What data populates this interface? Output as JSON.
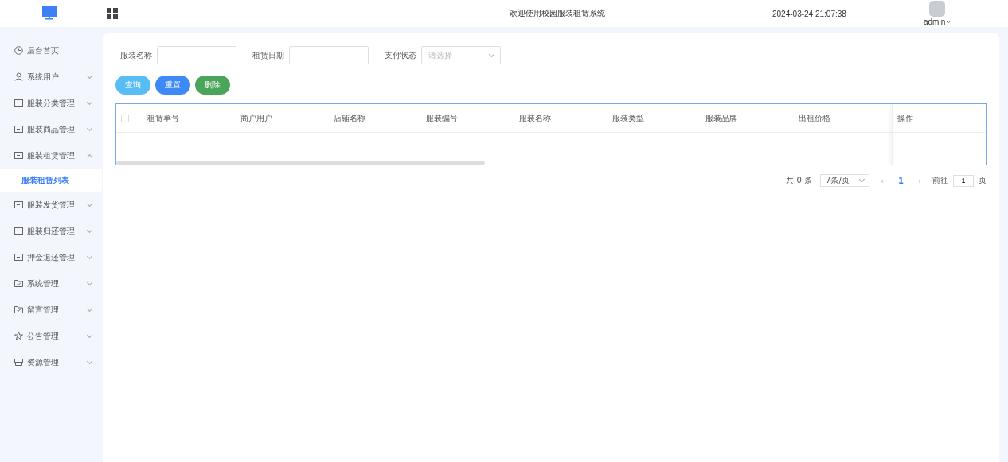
{
  "header": {
    "title": "欢迎使用校园服装租赁系统",
    "datetime": "2024-03-24 21:07:38",
    "user": "admin"
  },
  "sidebar": {
    "items": [
      {
        "label": "后台首页",
        "expandable": false
      },
      {
        "label": "系统用户",
        "expandable": true,
        "expanded": false
      },
      {
        "label": "服装分类管理",
        "expandable": true,
        "expanded": false
      },
      {
        "label": "服装商品管理",
        "expandable": true,
        "expanded": false
      },
      {
        "label": "服装租赁管理",
        "expandable": true,
        "expanded": true,
        "children": [
          {
            "label": "服装租赁列表",
            "selected": true
          }
        ]
      },
      {
        "label": "服装发货管理",
        "expandable": true,
        "expanded": false
      },
      {
        "label": "服装归还管理",
        "expandable": true,
        "expanded": false
      },
      {
        "label": "押金退还管理",
        "expandable": true,
        "expanded": false
      },
      {
        "label": "系统管理",
        "expandable": true,
        "expanded": false
      },
      {
        "label": "留言管理",
        "expandable": true,
        "expanded": false
      },
      {
        "label": "公告管理",
        "expandable": true,
        "expanded": false
      },
      {
        "label": "资源管理",
        "expandable": true,
        "expanded": false
      }
    ]
  },
  "filters": [
    {
      "label": "服装名称",
      "kind": "input"
    },
    {
      "label": "租赁日期",
      "kind": "input"
    },
    {
      "label": "支付状态",
      "kind": "select",
      "placeholder": "请选择"
    }
  ],
  "buttons": [
    {
      "label": "查询",
      "color": "#57bdf3"
    },
    {
      "label": "重置",
      "color": "#3d8af7"
    },
    {
      "label": "删除",
      "color": "#4aa45a"
    }
  ],
  "table": {
    "select_all": false,
    "columns": [
      "租赁单号",
      "商户用户",
      "店铺名称",
      "服装编号",
      "服装名称",
      "服装类型",
      "服装品牌",
      "出租价格"
    ],
    "action_column": "操作"
  },
  "pagination": {
    "total": "共 0 条",
    "page_size": "7条/页",
    "prev": "‹",
    "page": "1",
    "next": "›",
    "goto_label": "前往",
    "goto_value": "1",
    "goto_suffix": "页"
  }
}
